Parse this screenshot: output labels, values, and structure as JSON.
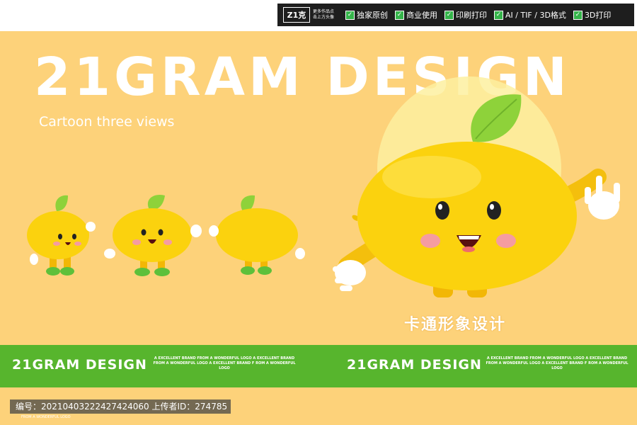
{
  "badges": {
    "logo_mark": "Z1克",
    "logo_text": "更多作品点击上方头像",
    "items": [
      {
        "label": "独家原创"
      },
      {
        "label": "商业使用"
      },
      {
        "label": "印刷打印"
      },
      {
        "label": "AI / TIF / 3D格式"
      },
      {
        "label": "3D打印"
      }
    ]
  },
  "hero": {
    "title": "21GRAM DESIGN",
    "subtitle": "Cartoon three views",
    "slogan": "卡通形象设计"
  },
  "bottom_bar": {
    "brand_left": "21GRAM DESIGN",
    "tagline_left": "A EXCELLENT BRAND FROM A WONDERFUL LOGO A EXCELLENT BRAND FROM A WONDERFUL LOGO A EXCELLENT BRAND F ROM A WONDERFUL LOGO",
    "brand_right": "21GRAM DESIGN",
    "tagline_right": "A EXCELLENT BRAND FROM A WONDERFUL LOGO A EXCELLENT BRAND FROM A WONDERFUL LOGO A EXCELLENT BRAND F ROM A WONDERFUL LOGO"
  },
  "footer": {
    "id_text": "编号：20210403222427424060 上传者ID：274785",
    "tiny_text": "FROM A WONDERFUL LOGO"
  },
  "colors": {
    "background": "#fdd27a",
    "green_bar": "#57b52d",
    "lemon": "#fbd20e",
    "leaf": "#8ed23a"
  }
}
